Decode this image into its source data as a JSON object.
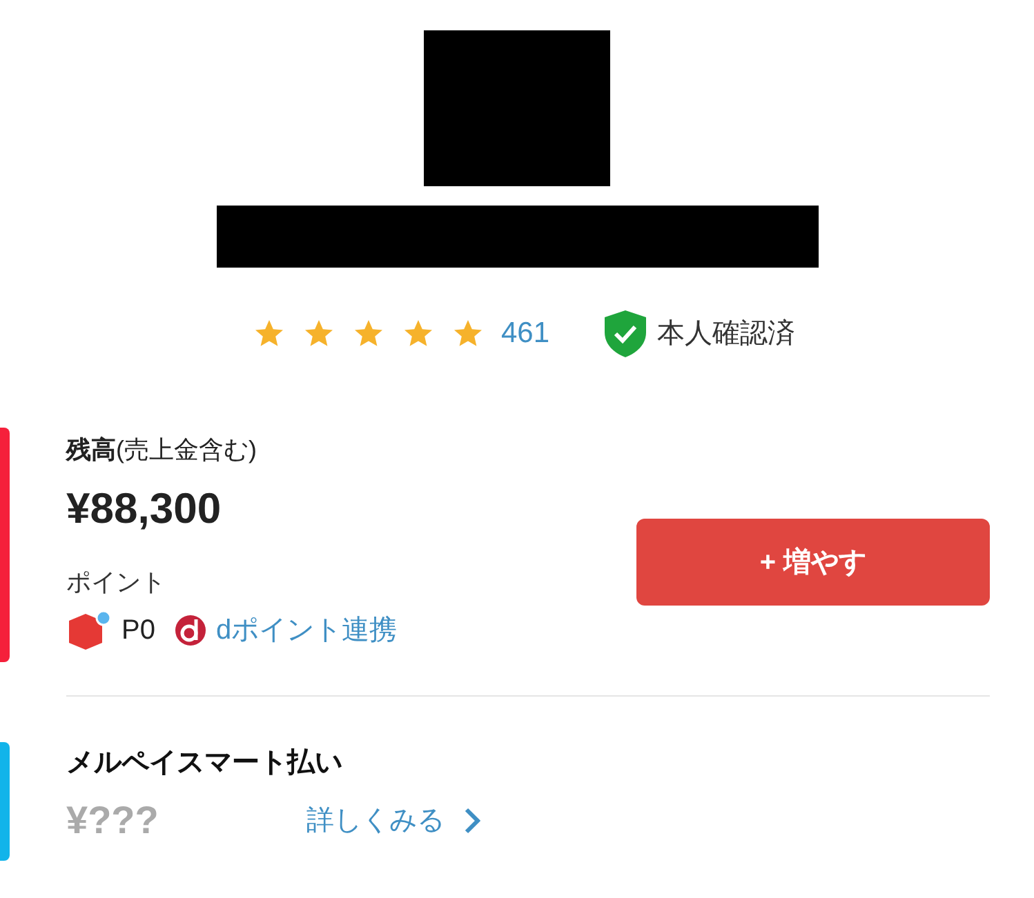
{
  "profile": {
    "stars": 5,
    "review_count": "461",
    "verified": true,
    "verified_label": "本人確認済"
  },
  "balance": {
    "label": "**残高**(売上金含む)",
    "amount": "¥88,300",
    "points_label": "ポイント",
    "points": "P0",
    "dpoint_link": "dポイント連携",
    "add_button": "+ 増やす"
  },
  "smart_pay": {
    "title": "メルペイスマート払い",
    "amount": "¥???",
    "details_link": "詳しくみる"
  }
}
